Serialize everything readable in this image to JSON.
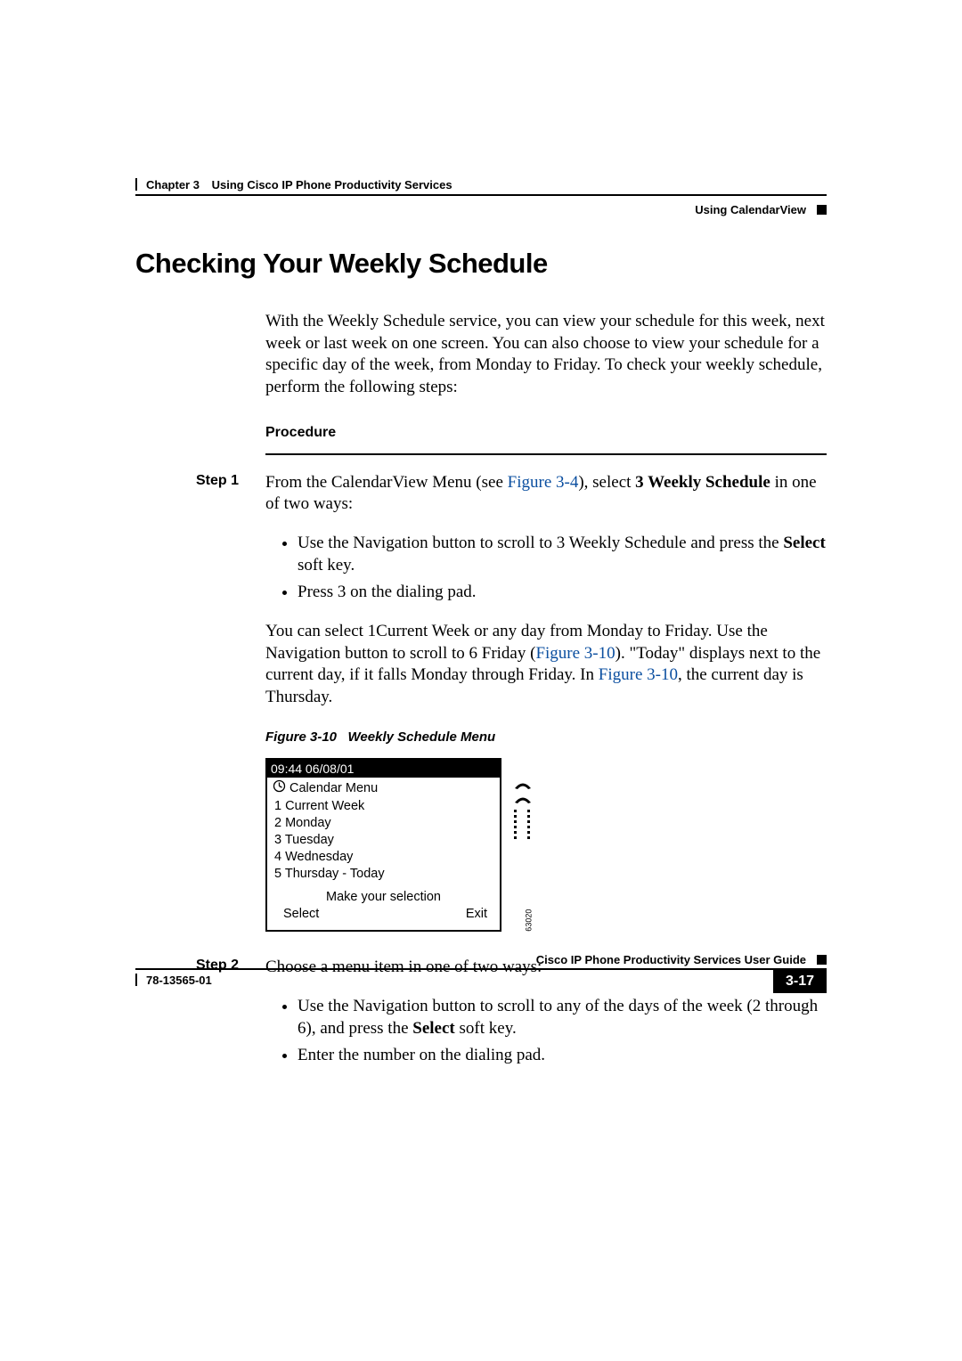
{
  "header": {
    "chapter_label": "Chapter 3",
    "chapter_title": "Using Cisco IP Phone Productivity Services",
    "section_breadcrumb": "Using CalendarView"
  },
  "section_heading": "Checking Your Weekly Schedule",
  "intro": "With the Weekly Schedule service, you can view your schedule for this week, next week or last week on one screen. You can also choose to view your schedule for a specific day of the week, from Monday to Friday. To check your weekly schedule, perform the following steps:",
  "procedure_label": "Procedure",
  "step1": {
    "label": "Step 1",
    "p1_pre": "From the CalendarView Menu (see ",
    "p1_link1": "Figure 3-4",
    "p1_mid": "), select ",
    "p1_bold": "3 Weekly Schedule",
    "p1_post": " in one of two ways:",
    "bullets": {
      "b1_pre": "Use the Navigation button to scroll to 3 Weekly Schedule and press the ",
      "b1_bold": "Select",
      "b1_post": " soft key.",
      "b2": "Press 3 on the dialing pad."
    },
    "p2_a": "You can select 1Current Week or any day from Monday to Friday. Use the Navigation button to scroll to 6 Friday (",
    "p2_link1": "Figure 3-10",
    "p2_b": "). \"Today\" displays next to the current day, if it falls Monday through Friday. In ",
    "p2_link2": "Figure 3-10",
    "p2_c": ", the current day is Thursday."
  },
  "figure": {
    "caption_label": "Figure 3-10",
    "caption_title": "Weekly Schedule Menu",
    "timebar": "09:44 06/08/01",
    "menu_title": "Calendar Menu",
    "items": {
      "i1": "1 Current Week",
      "i2": "2 Monday",
      "i3": "3 Tuesday",
      "i4": "4 Wednesday",
      "i5": "5 Thursday  -  Today"
    },
    "prompt": "Make your selection",
    "softkeys": {
      "left": "Select",
      "right": "Exit"
    },
    "side_number": "63020"
  },
  "step2": {
    "label": "Step 2",
    "p1": "Choose a menu item in one of two ways:",
    "bullets": {
      "b1_pre": "Use the Navigation button to scroll to any of the days of the week (2 through 6), and press the ",
      "b1_bold": "Select",
      "b1_post": " soft key.",
      "b2": "Enter the number on the dialing pad."
    }
  },
  "footer": {
    "book_title": "Cisco IP Phone Productivity Services User Guide",
    "doc_number": "78-13565-01",
    "page_number": "3-17"
  }
}
